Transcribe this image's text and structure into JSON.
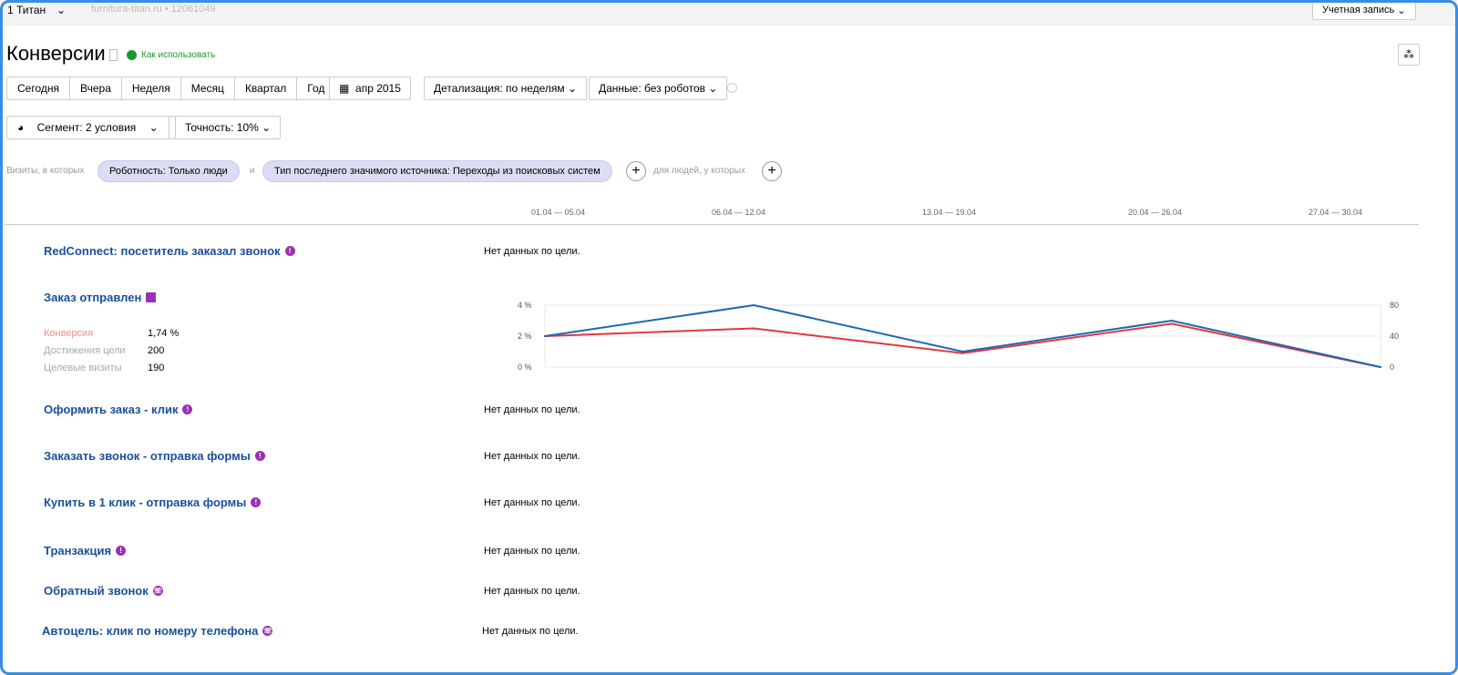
{
  "topbar": {
    "counter": "1 Титан",
    "site": "furnitura-titan.ru • 12061049",
    "account": "Учетная запись"
  },
  "page": {
    "title": "Конверсии",
    "help": "Как использовать"
  },
  "periods": [
    "Сегодня",
    "Вчера",
    "Неделя",
    "Месяц",
    "Квартал",
    "Год"
  ],
  "date_range": "апр 2015",
  "detail": "Детализация: по неделям",
  "data_filter": "Данные: без роботов",
  "segment": "Сегмент: 2 условия",
  "accuracy": "Точность: 10%",
  "filters": {
    "prefix": "Визиты, в которых",
    "chip1": "Роботность: Только люди",
    "and": "и",
    "chip2": "Тип последнего значимого источника: Переходы из поисковых систем",
    "people": "для людей, у которых"
  },
  "weeks": [
    "01.04 — 05.04",
    "06.04 — 12.04",
    "13.04 — 19.04",
    "20.04 — 26.04",
    "27.04 — 30.04"
  ],
  "no_data": "Нет данных по цели.",
  "goals": [
    {
      "name": "RedConnect: посетитель заказал звонок"
    },
    {
      "name": "Заказ отправлен"
    },
    {
      "name": "Оформить заказ - клик"
    },
    {
      "name": "Заказать звонок - отправка формы"
    },
    {
      "name": "Купить в 1 клик - отправка формы"
    },
    {
      "name": "Транзакция"
    },
    {
      "name": "Обратный звонок"
    },
    {
      "name": "Автоцель: клик по номеру телефона"
    }
  ],
  "stats": {
    "conv_label": "Конверсия",
    "conv": "1,74 %",
    "reach_label": "Достижения цели",
    "reach": "200",
    "visits_label": "Целевые визиты",
    "visits": "190"
  },
  "chart_data": {
    "type": "line",
    "x": [
      "01.04 — 05.04",
      "06.04 — 12.04",
      "13.04 — 19.04",
      "20.04 — 26.04",
      "27.04 — 30.04"
    ],
    "left_ticks": [
      "0 %",
      "2 %",
      "4 %"
    ],
    "right_ticks": [
      "0",
      "40",
      "80"
    ],
    "ylim_left": [
      0,
      4
    ],
    "ylim_right": [
      0,
      80
    ],
    "series": [
      {
        "name": "Конверсия",
        "axis": "left",
        "color": "#e0393e",
        "values": [
          2.0,
          2.5,
          0.9,
          2.8,
          0
        ]
      },
      {
        "name": "Визиты",
        "axis": "right",
        "color": "#1f67b1",
        "values": [
          40,
          80,
          20,
          60,
          0
        ]
      }
    ]
  }
}
